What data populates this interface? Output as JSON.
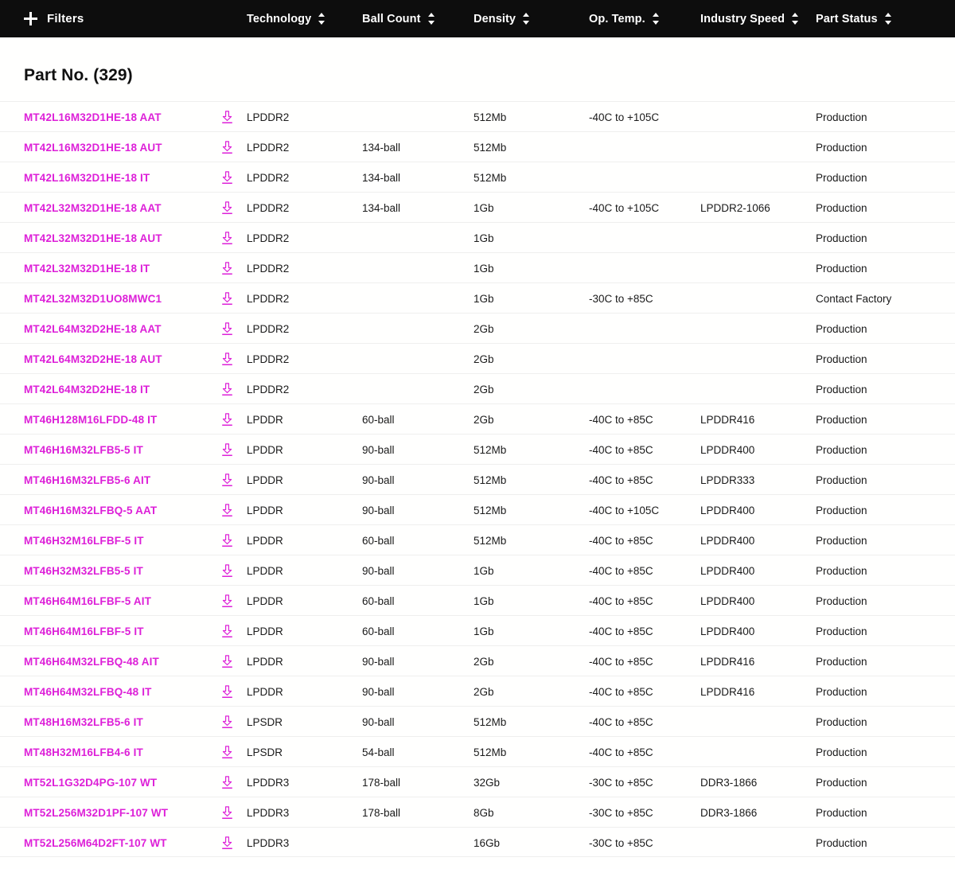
{
  "toolbar": {
    "filters_label": "Filters",
    "filters_icon": "plus-icon",
    "columns": [
      {
        "label": "Technology",
        "sort_icon": "sort-updown-icon"
      },
      {
        "label": "Ball Count",
        "sort_icon": "sort-updown-icon"
      },
      {
        "label": "Density",
        "sort_icon": "sort-updown-icon"
      },
      {
        "label": "Op. Temp.",
        "sort_icon": "sort-updown-icon"
      },
      {
        "label": "Industry Speed",
        "sort_icon": "sort-updown-icon"
      },
      {
        "label": "Part Status",
        "sort_icon": "sort-updown-icon"
      }
    ]
  },
  "page": {
    "title": "Part No. (329)"
  },
  "colors": {
    "toolbar_bg": "#0D0D0D",
    "link": "#DD20D8",
    "page_bg": "#FFFFFE",
    "row_divider": "#EFEFEE",
    "text": "#1A1A1A"
  },
  "table": {
    "download_icon": "download-icon",
    "rows": [
      {
        "part": "MT42L16M32D1HE-18 AAT",
        "technology": "LPDDR2",
        "ball_count": "",
        "density": "512Mb",
        "op_temp": "-40C to +105C",
        "industry_speed": "",
        "part_status": "Production"
      },
      {
        "part": "MT42L16M32D1HE-18 AUT",
        "technology": "LPDDR2",
        "ball_count": "134-ball",
        "density": "512Mb",
        "op_temp": "",
        "industry_speed": "",
        "part_status": "Production"
      },
      {
        "part": "MT42L16M32D1HE-18 IT",
        "technology": "LPDDR2",
        "ball_count": "134-ball",
        "density": "512Mb",
        "op_temp": "",
        "industry_speed": "",
        "part_status": "Production"
      },
      {
        "part": "MT42L32M32D1HE-18 AAT",
        "technology": "LPDDR2",
        "ball_count": "134-ball",
        "density": "1Gb",
        "op_temp": "-40C to +105C",
        "industry_speed": "LPDDR2-1066",
        "part_status": "Production"
      },
      {
        "part": "MT42L32M32D1HE-18 AUT",
        "technology": "LPDDR2",
        "ball_count": "",
        "density": "1Gb",
        "op_temp": "",
        "industry_speed": "",
        "part_status": "Production"
      },
      {
        "part": "MT42L32M32D1HE-18 IT",
        "technology": "LPDDR2",
        "ball_count": "",
        "density": "1Gb",
        "op_temp": "",
        "industry_speed": "",
        "part_status": "Production"
      },
      {
        "part": "MT42L32M32D1UO8MWC1",
        "technology": "LPDDR2",
        "ball_count": "",
        "density": "1Gb",
        "op_temp": "-30C to +85C",
        "industry_speed": "",
        "part_status": "Contact Factory"
      },
      {
        "part": "MT42L64M32D2HE-18 AAT",
        "technology": "LPDDR2",
        "ball_count": "",
        "density": "2Gb",
        "op_temp": "",
        "industry_speed": "",
        "part_status": "Production"
      },
      {
        "part": "MT42L64M32D2HE-18 AUT",
        "technology": "LPDDR2",
        "ball_count": "",
        "density": "2Gb",
        "op_temp": "",
        "industry_speed": "",
        "part_status": "Production"
      },
      {
        "part": "MT42L64M32D2HE-18 IT",
        "technology": "LPDDR2",
        "ball_count": "",
        "density": "2Gb",
        "op_temp": "",
        "industry_speed": "",
        "part_status": "Production"
      },
      {
        "part": "MT46H128M16LFDD-48 IT",
        "technology": "LPDDR",
        "ball_count": "60-ball",
        "density": "2Gb",
        "op_temp": "-40C to +85C",
        "industry_speed": "LPDDR416",
        "part_status": "Production"
      },
      {
        "part": "MT46H16M32LFB5-5 IT",
        "technology": "LPDDR",
        "ball_count": "90-ball",
        "density": "512Mb",
        "op_temp": "-40C to +85C",
        "industry_speed": "LPDDR400",
        "part_status": "Production"
      },
      {
        "part": "MT46H16M32LFB5-6 AIT",
        "technology": "LPDDR",
        "ball_count": "90-ball",
        "density": "512Mb",
        "op_temp": "-40C to +85C",
        "industry_speed": "LPDDR333",
        "part_status": "Production"
      },
      {
        "part": "MT46H16M32LFBQ-5 AAT",
        "technology": "LPDDR",
        "ball_count": "90-ball",
        "density": "512Mb",
        "op_temp": "-40C to +105C",
        "industry_speed": "LPDDR400",
        "part_status": "Production"
      },
      {
        "part": "MT46H32M16LFBF-5 IT",
        "technology": "LPDDR",
        "ball_count": "60-ball",
        "density": "512Mb",
        "op_temp": "-40C to +85C",
        "industry_speed": "LPDDR400",
        "part_status": "Production"
      },
      {
        "part": "MT46H32M32LFB5-5 IT",
        "technology": "LPDDR",
        "ball_count": "90-ball",
        "density": "1Gb",
        "op_temp": "-40C to +85C",
        "industry_speed": "LPDDR400",
        "part_status": "Production"
      },
      {
        "part": "MT46H64M16LFBF-5 AIT",
        "technology": "LPDDR",
        "ball_count": "60-ball",
        "density": "1Gb",
        "op_temp": "-40C to +85C",
        "industry_speed": "LPDDR400",
        "part_status": "Production"
      },
      {
        "part": "MT46H64M16LFBF-5 IT",
        "technology": "LPDDR",
        "ball_count": "60-ball",
        "density": "1Gb",
        "op_temp": "-40C to +85C",
        "industry_speed": "LPDDR400",
        "part_status": "Production"
      },
      {
        "part": "MT46H64M32LFBQ-48 AIT",
        "technology": "LPDDR",
        "ball_count": "90-ball",
        "density": "2Gb",
        "op_temp": "-40C to +85C",
        "industry_speed": "LPDDR416",
        "part_status": "Production"
      },
      {
        "part": "MT46H64M32LFBQ-48 IT",
        "technology": "LPDDR",
        "ball_count": "90-ball",
        "density": "2Gb",
        "op_temp": "-40C to +85C",
        "industry_speed": "LPDDR416",
        "part_status": "Production"
      },
      {
        "part": "MT48H16M32LFB5-6 IT",
        "technology": "LPSDR",
        "ball_count": "90-ball",
        "density": "512Mb",
        "op_temp": "-40C to +85C",
        "industry_speed": "",
        "part_status": "Production"
      },
      {
        "part": "MT48H32M16LFB4-6 IT",
        "technology": "LPSDR",
        "ball_count": "54-ball",
        "density": "512Mb",
        "op_temp": "-40C to +85C",
        "industry_speed": "",
        "part_status": "Production"
      },
      {
        "part": "MT52L1G32D4PG-107 WT",
        "technology": "LPDDR3",
        "ball_count": "178-ball",
        "density": "32Gb",
        "op_temp": "-30C to +85C",
        "industry_speed": "DDR3-1866",
        "part_status": "Production"
      },
      {
        "part": "MT52L256M32D1PF-107 WT",
        "technology": "LPDDR3",
        "ball_count": "178-ball",
        "density": "8Gb",
        "op_temp": "-30C to +85C",
        "industry_speed": "DDR3-1866",
        "part_status": "Production"
      },
      {
        "part": "MT52L256M64D2FT-107 WT",
        "technology": "LPDDR3",
        "ball_count": "",
        "density": "16Gb",
        "op_temp": "-30C to +85C",
        "industry_speed": "",
        "part_status": "Production"
      }
    ]
  }
}
